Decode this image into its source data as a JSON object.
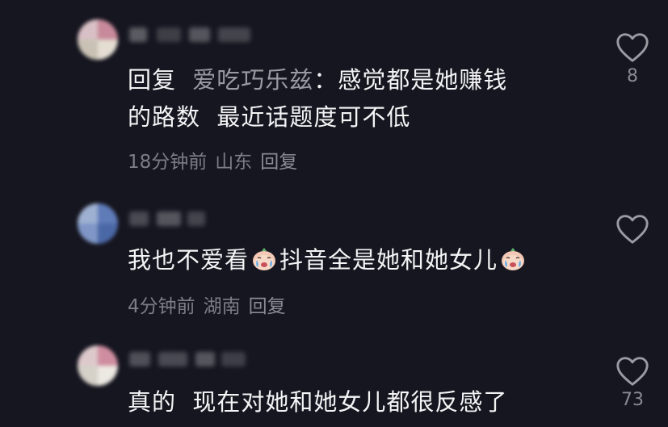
{
  "comments": [
    {
      "reply_prefix": "回复",
      "reply_to": "爱吃巧乐兹",
      "separator": "：",
      "line1": "感觉都是她赚钱",
      "line2": "的路数  最近话题度可不低",
      "time": "18分钟前",
      "location": "山东",
      "reply_label": "回复",
      "likes": "8"
    },
    {
      "part1": "我也不爱看",
      "part2": "抖音全是她和她女儿",
      "time": "4分钟前",
      "location": "湖南",
      "reply_label": "回复",
      "likes": ""
    },
    {
      "line1": "真的  现在对她和她女儿都很反感了",
      "likes": "73"
    }
  ],
  "icons": {
    "like": "heart-outline-icon",
    "emoji": "crying-face-emoji"
  },
  "colors": {
    "background": "#161620",
    "text": "#f4f4f6",
    "muted": "#9a9aa2",
    "meta": "#7d7d86"
  }
}
